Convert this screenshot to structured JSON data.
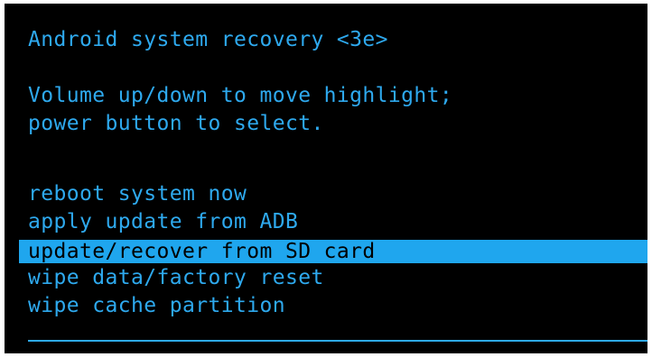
{
  "header": {
    "title": "Android system recovery <3e>",
    "instruction_1": "Volume up/down to move highlight;",
    "instruction_2": "power button to select."
  },
  "menu": {
    "selected_index": 2,
    "items": [
      {
        "label": "reboot system now"
      },
      {
        "label": "apply update from ADB"
      },
      {
        "label": "update/recover from SD card"
      },
      {
        "label": "wipe data/factory reset"
      },
      {
        "label": "wipe cache partition"
      }
    ]
  },
  "colors": {
    "text": "#2ea9ee",
    "highlight": "#1fa6ee",
    "background": "#000000"
  }
}
